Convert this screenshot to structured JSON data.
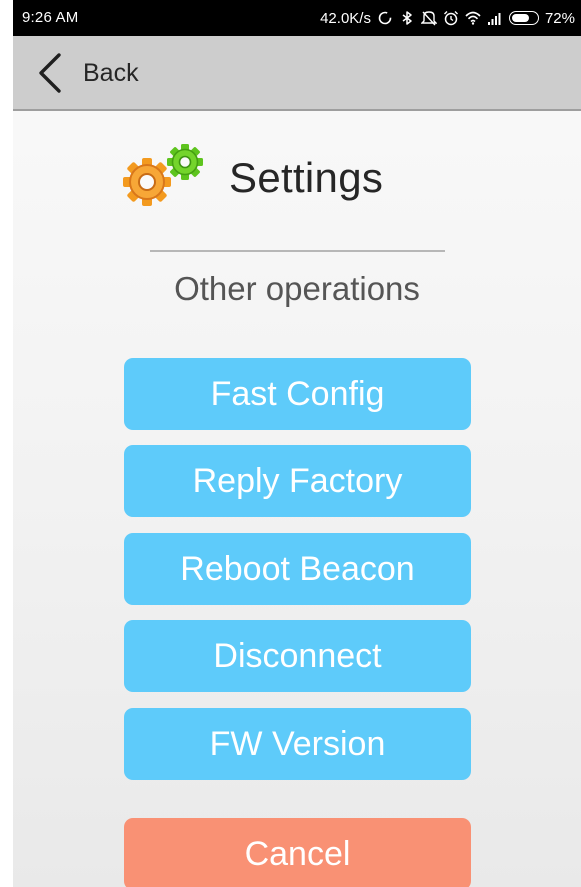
{
  "status_bar": {
    "time": "9:26 AM",
    "net_speed": "42.0K/s",
    "battery_pct": "72%",
    "icons": [
      "sync-icon",
      "bluetooth-icon",
      "mute-icon",
      "alarm-icon",
      "wifi-icon",
      "signal-icon",
      "battery-icon"
    ],
    "battery_level": 0.72
  },
  "nav": {
    "back_label": "Back"
  },
  "header": {
    "title": "Settings",
    "icon": "settings-gears-icon"
  },
  "section": {
    "title": "Other operations"
  },
  "buttons": {
    "fast_config": "Fast Config",
    "reply_factory": "Reply Factory",
    "reboot_beacon": "Reboot Beacon",
    "disconnect": "Disconnect",
    "fw_version": "FW Version",
    "cancel": "Cancel"
  },
  "colors": {
    "primary_button": "#5ecbfa",
    "cancel_button": "#f99174",
    "nav_bar": "#cdcdcd"
  }
}
